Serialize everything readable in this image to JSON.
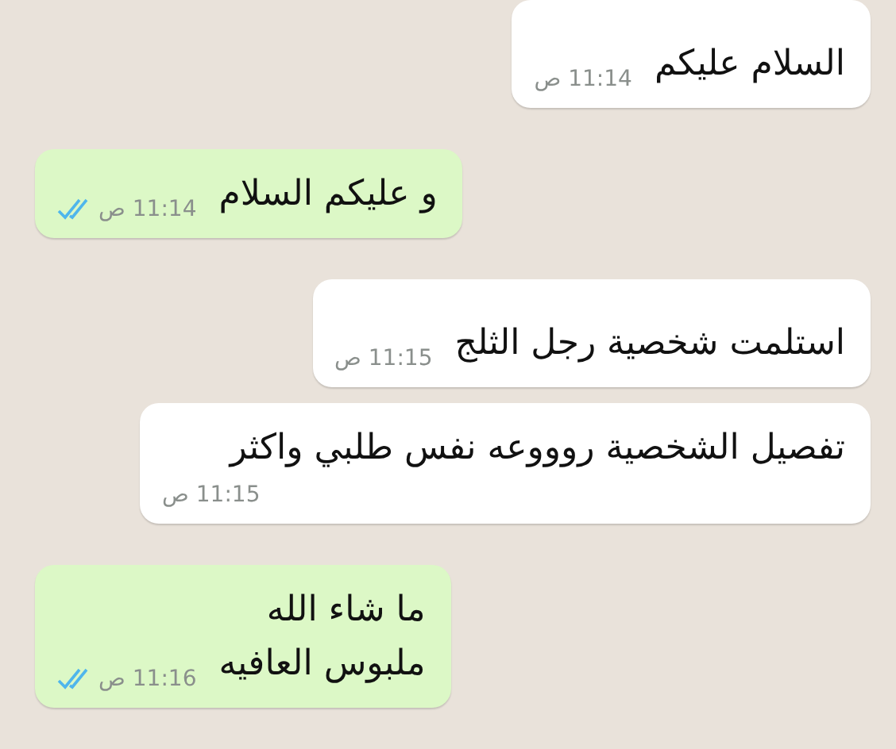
{
  "messages": [
    {
      "kind": "incoming",
      "text": "السلام عليكم",
      "time": "11:14 ص"
    },
    {
      "kind": "outgoing",
      "text": "و عليكم السلام",
      "time": "11:14 ص",
      "read": true
    },
    {
      "kind": "incoming",
      "text": "استلمت شخصية رجل الثلج",
      "time": "11:15 ص"
    },
    {
      "kind": "incoming",
      "text": "تفصيل الشخصية روووعه نفس طلبي واكثر",
      "time": "11:15 ص"
    },
    {
      "kind": "outgoing",
      "text": "ما شاء الله\nملبوس العافيه",
      "time": "11:16 ص",
      "read": true
    }
  ]
}
